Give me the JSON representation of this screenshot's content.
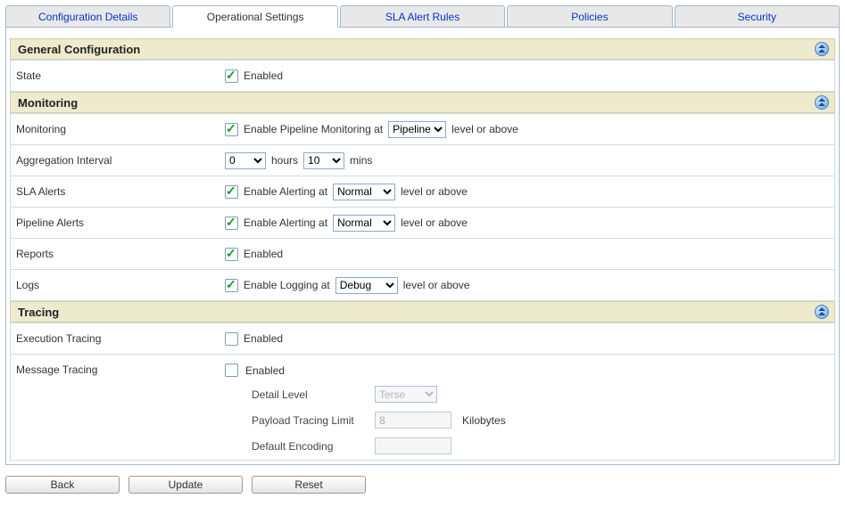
{
  "tabs": {
    "config_details": "Configuration Details",
    "operational": "Operational Settings",
    "sla_rules": "SLA Alert Rules",
    "policies": "Policies",
    "security": "Security"
  },
  "sections": {
    "general": "General Configuration",
    "monitoring": "Monitoring",
    "tracing": "Tracing"
  },
  "labels": {
    "state": "State",
    "monitoring": "Monitoring",
    "agg_interval": "Aggregation Interval",
    "sla_alerts": "SLA Alerts",
    "pipeline_alerts": "Pipeline Alerts",
    "reports": "Reports",
    "logs": "Logs",
    "exec_tracing": "Execution Tracing",
    "msg_tracing": "Message Tracing",
    "detail_level": "Detail Level",
    "payload_limit": "Payload Tracing Limit",
    "default_encoding": "Default Encoding"
  },
  "text": {
    "enabled": "Enabled",
    "enable_pipeline_at": "Enable Pipeline Monitoring at",
    "level_or_above": "level or above",
    "hours": "hours",
    "mins": "mins",
    "enable_alerting_at": "Enable Alerting at",
    "enable_logging_at": "Enable Logging at",
    "kilobytes": "Kilobytes"
  },
  "values": {
    "state_checked": true,
    "monitoring_checked": true,
    "monitoring_level": "Pipeline",
    "agg_hours": "0",
    "agg_mins": "10",
    "sla_checked": true,
    "sla_level": "Normal",
    "pipe_alert_checked": true,
    "pipe_alert_level": "Normal",
    "reports_checked": true,
    "logs_checked": true,
    "logs_level": "Debug",
    "exec_checked": false,
    "msg_checked": false,
    "detail_level": "Terse",
    "payload_limit": "8",
    "default_encoding": ""
  },
  "buttons": {
    "back": "Back",
    "update": "Update",
    "reset": "Reset"
  }
}
